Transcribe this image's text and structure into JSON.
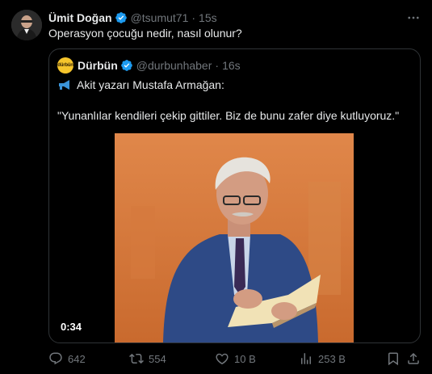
{
  "tweet": {
    "author_name": "Ümit Doğan",
    "handle": "@tsumut71",
    "separator": "·",
    "time": "15s",
    "text": "Operasyon çocuğu nedir, nasıl olunur?"
  },
  "quote": {
    "avatar_text": "dürbün",
    "author_name": "Dürbün",
    "handle": "@durbunhaber",
    "separator": "·",
    "time": "16s",
    "line1_text": "Akit yazarı Mustafa Armağan:",
    "line2_text": "\"Yunanlılar kendileri çekip gittiler. Biz de bunu zafer diye kutluyoruz.\"",
    "video_duration": "0:34"
  },
  "actions": {
    "replies": "642",
    "reposts": "554",
    "likes": "10 B",
    "views": "253 B"
  },
  "colors": {
    "background": "#000000",
    "text_primary": "#e7e9ea",
    "text_secondary": "#71767b",
    "verified": "#1d9bf0",
    "border": "#2f3336",
    "megaphone": "#3b94d9",
    "video_bg": "#d9783e"
  },
  "icons": [
    "verified-badge-icon",
    "more-icon",
    "megaphone-icon",
    "reply-icon",
    "repost-icon",
    "like-icon",
    "views-icon",
    "bookmark-icon",
    "share-icon"
  ]
}
